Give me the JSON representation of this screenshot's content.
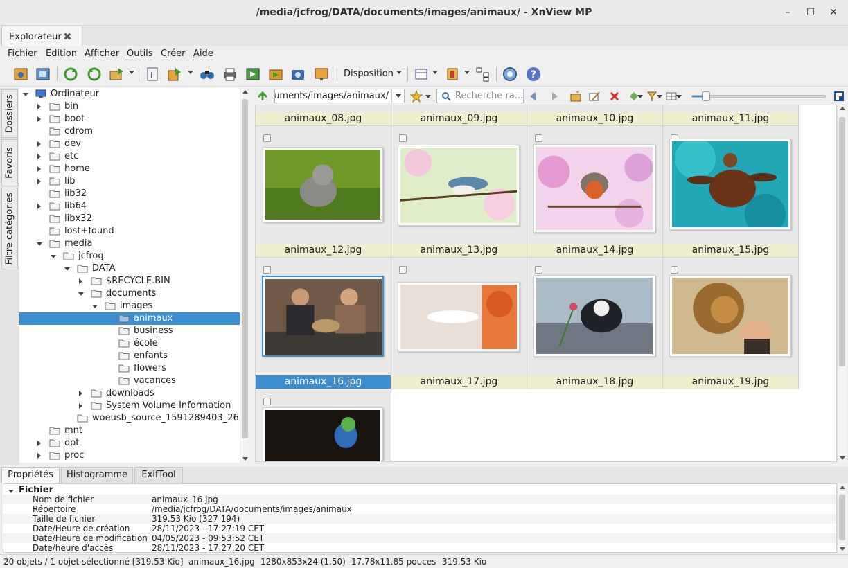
{
  "window": {
    "title": "/media/jcfrog/DATA/documents/images/animaux/ - XnView MP"
  },
  "doc_tab": {
    "label": "Explorateur"
  },
  "menu": [
    {
      "first": "F",
      "rest": "ichier"
    },
    {
      "first": "E",
      "rest": "dition"
    },
    {
      "first": "A",
      "rest": "fficher"
    },
    {
      "first": "O",
      "rest": "utils"
    },
    {
      "first": "C",
      "rest": "réer"
    },
    {
      "first": "A",
      "rest": "ide"
    }
  ],
  "toolbar": {
    "disposition_label": "Disposition"
  },
  "side_tabs": [
    "Dossiers",
    "Favoris",
    "Filtre catégories"
  ],
  "tree": [
    {
      "label": "Ordinateur",
      "expander": "open",
      "icon": "computer-icon"
    },
    {
      "label": "bin",
      "expander": "closed"
    },
    {
      "label": "boot",
      "expander": "closed"
    },
    {
      "label": "cdrom",
      "expander": "none"
    },
    {
      "label": "dev",
      "expander": "closed"
    },
    {
      "label": "etc",
      "expander": "closed"
    },
    {
      "label": "home",
      "expander": "closed"
    },
    {
      "label": "lib",
      "expander": "closed"
    },
    {
      "label": "lib32",
      "expander": "none"
    },
    {
      "label": "lib64",
      "expander": "closed"
    },
    {
      "label": "libx32",
      "expander": "none"
    },
    {
      "label": "lost+found",
      "expander": "none"
    },
    {
      "label": "media",
      "expander": "open"
    },
    {
      "label": "jcfrog",
      "expander": "open"
    },
    {
      "label": "DATA",
      "expander": "open"
    },
    {
      "label": "$RECYCLE.BIN",
      "expander": "closed"
    },
    {
      "label": "documents",
      "expander": "open"
    },
    {
      "label": "images",
      "expander": "open"
    },
    {
      "label": "animaux",
      "expander": "none",
      "selected": true
    },
    {
      "label": "business",
      "expander": "none"
    },
    {
      "label": "école",
      "expander": "none"
    },
    {
      "label": "enfants",
      "expander": "none"
    },
    {
      "label": "flowers",
      "expander": "none"
    },
    {
      "label": "vacances",
      "expander": "none"
    },
    {
      "label": "downloads",
      "expander": "closed"
    },
    {
      "label": "System Volume Information",
      "expander": "closed"
    },
    {
      "label": "woeusb_source_1591289403_26306",
      "expander": "none"
    },
    {
      "label": "mnt",
      "expander": "none"
    },
    {
      "label": "opt",
      "expander": "closed"
    },
    {
      "label": "proc",
      "expander": "closed"
    }
  ],
  "address": {
    "path": "ocuments/images/animaux/",
    "search_placeholder": "Recherche ra..."
  },
  "thumbnails": {
    "top_partial_captions": [
      "animaux_08.jpg",
      "animaux_09.jpg",
      "animaux_10.jpg",
      "animaux_11.jpg"
    ],
    "items": [
      {
        "caption": "animaux_12.jpg",
        "subject": "kitten-photo"
      },
      {
        "caption": "animaux_13.jpg",
        "subject": "bird-on-blossom-photo"
      },
      {
        "caption": "animaux_14.jpg",
        "subject": "robin-photo"
      },
      {
        "caption": "animaux_15.jpg",
        "subject": "sea-turtle-photo"
      },
      {
        "caption": "animaux_16.jpg",
        "subject": "couple-with-dog-photo",
        "selected": true
      },
      {
        "caption": "animaux_17.jpg",
        "subject": "white-dove-photo"
      },
      {
        "caption": "animaux_18.jpg",
        "subject": "kitten-with-flower-photo"
      },
      {
        "caption": "animaux_19.jpg",
        "subject": "lion-and-child-photo"
      },
      {
        "caption": "",
        "subject": "parrot-photo"
      }
    ]
  },
  "bottom_tabs": [
    "Propriétés",
    "Histogramme",
    "ExifTool"
  ],
  "properties": {
    "section": "Fichier",
    "rows": [
      {
        "key": "Nom de fichier",
        "value": "animaux_16.jpg"
      },
      {
        "key": "Répertoire",
        "value": "/media/jcfrog/DATA/documents/images/animaux"
      },
      {
        "key": "Taille de fichier",
        "value": "319.53 Kio (327 194)"
      },
      {
        "key": "Date/Heure de création",
        "value": "28/11/2023 - 17:27:19 CET"
      },
      {
        "key": "Date/Heure de modification",
        "value": "04/05/2023 - 09:53:52 CET"
      },
      {
        "key": "Date/heure d'accès",
        "value": "28/11/2023 - 17:27:20 CET"
      }
    ]
  },
  "status": {
    "objects": "20 objets / 1 objet sélectionné [319.53 Kio]",
    "filename": "animaux_16.jpg",
    "dimensions": "1280x853x24 (1.50)",
    "inches": "17.78x11.85 pouces",
    "size": "319.53 Kio"
  },
  "colors": {
    "selection": "#3b8fd0",
    "caption_bg": "#efefcf"
  }
}
